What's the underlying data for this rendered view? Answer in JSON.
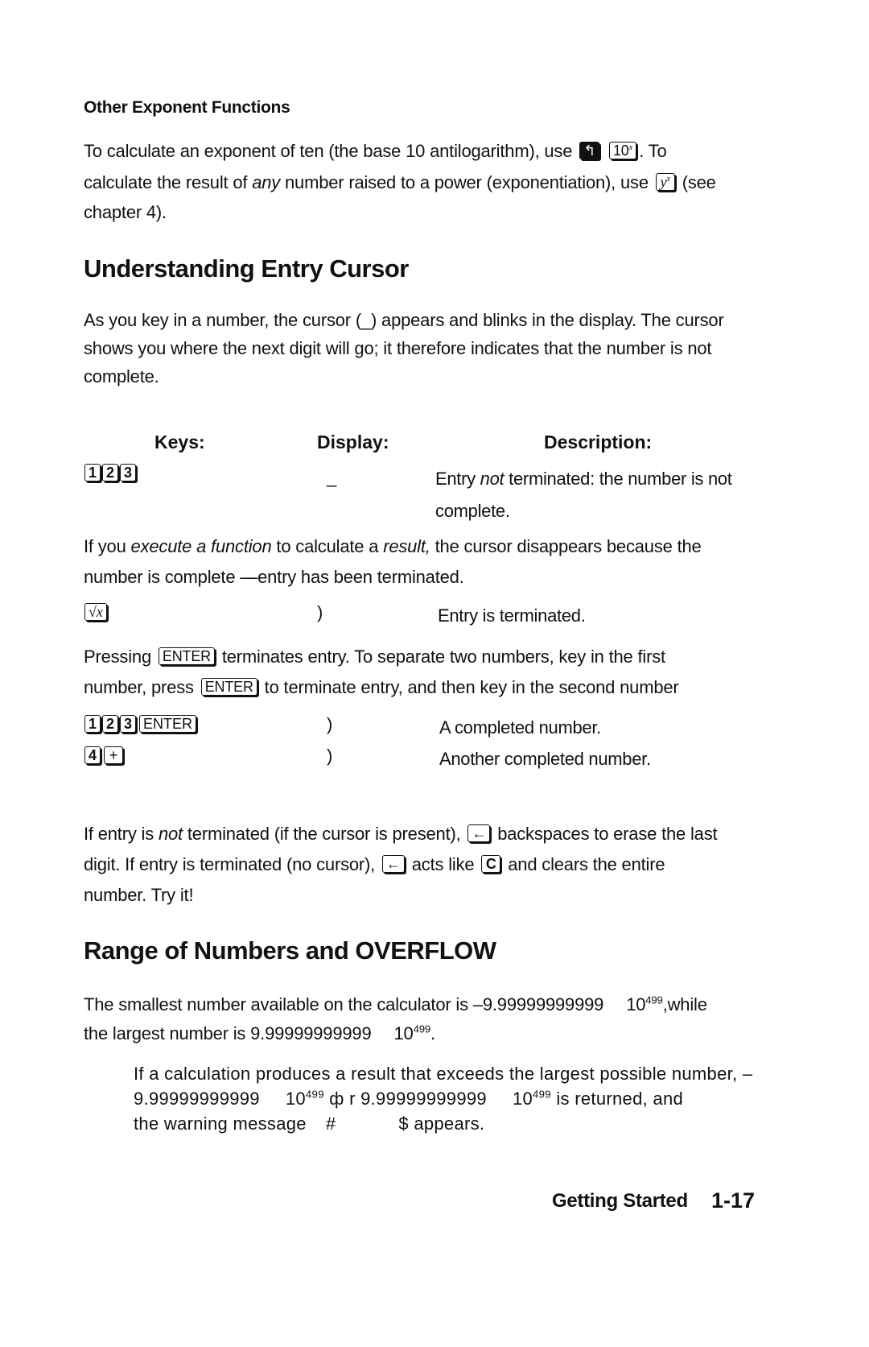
{
  "section_other": {
    "heading": "Other Exponent Functions",
    "p1_a": "To calculate an exponent of ten (the base 10 antilogarithm), use",
    "key_shift": "↰",
    "key_10x_base": "10",
    "key_10x_exp": "x",
    "p1_b": ". To",
    "p2_a": "calculate the result of",
    "p2_any": "any",
    "p2_b": "number raised to a power (exponentiation), use",
    "key_yx_base": "y",
    "key_yx_exp": "x",
    "p2_c": "(see",
    "p3": "chapter 4)."
  },
  "section_cursor": {
    "heading": "Understanding Entry Cursor",
    "intro": [
      "As you key in a number, the cursor (_) appears and blinks in the display. The cursor",
      "shows you where the next digit will go; it therefore indicates that the number is not",
      "complete."
    ],
    "table_headers": {
      "keys": "Keys:",
      "display": "Display:",
      "description": "Description:"
    },
    "row1": {
      "keys": [
        "1",
        "2",
        "3"
      ],
      "display": "_",
      "desc_a": "Entry",
      "desc_not": "not",
      "desc_b": "terminated: the number is not",
      "desc_c": "complete."
    },
    "execute_p": {
      "a": "If you",
      "italic1": "execute a function",
      "b": "to calculate a",
      "italic2": "result,",
      "c": "the cursor disappears because the",
      "line2": "number is complete —entry has been terminated."
    },
    "row2": {
      "key": "√x",
      "display": ")",
      "desc": "Entry is terminated."
    },
    "pressing_p": {
      "a": "Pressing",
      "key": "ENTER",
      "b": "terminates entry. To separate two numbers, key in the first",
      "c": "number, press",
      "d": "to terminate entry, and then key in the second number"
    },
    "row3": {
      "keys": [
        "1",
        "2",
        "3"
      ],
      "enter": "ENTER",
      "display": ")",
      "desc": "A completed number."
    },
    "row4": {
      "keys": [
        "4",
        "+"
      ],
      "display": ")",
      "desc": "Another completed number."
    },
    "backspace_p": {
      "a": "If entry is",
      "not": "not",
      "b": "terminated (if the cursor is present),",
      "backspace_key": "←",
      "c": "backspaces to erase the last",
      "d": "digit. If entry is terminated (no cursor),",
      "e": "acts like",
      "c_key": "C",
      "f": "and clears the entire",
      "g": "number. Try it!"
    }
  },
  "section_range": {
    "heading": "Range of Numbers and OVERFLOW",
    "p1_a": "The smallest number available on the calculator is –9.99999999999",
    "p1_b": "10",
    "p1_exp": "499",
    "p1_c": ",while",
    "p2_a": "the largest number is 9.99999999999",
    "p2_b": "10",
    "p2_exp": "499",
    "p2_c": ".",
    "note_l1": "If a calculation produces a result that exceeds the largest possible number, –",
    "note_l2_a": "9.99999999999",
    "note_l2_b": "10",
    "note_l2_exp": "499",
    "note_l2_c": "ф r 9.99999999999",
    "note_l2_d": "10",
    "note_l2_exp2": "499",
    "note_l2_e": "is returned, and",
    "note_l3_a": "the warning message",
    "note_l3_hash": "#",
    "note_l3_b": "$ appears."
  },
  "footer": {
    "chapter": "Getting Started",
    "page": "1-17"
  }
}
